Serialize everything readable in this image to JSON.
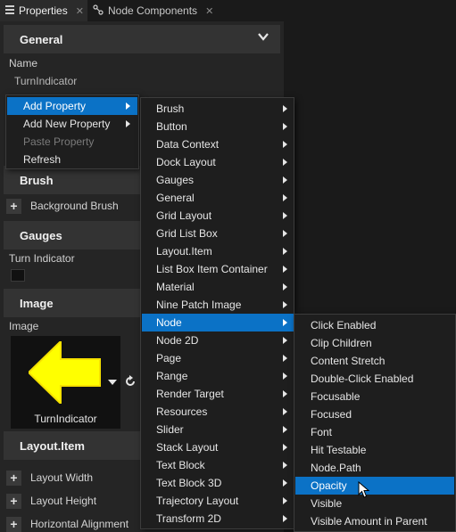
{
  "tabs": [
    {
      "label": "Properties",
      "icon": "properties-icon"
    },
    {
      "label": "Node Components",
      "icon": "node-components-icon"
    }
  ],
  "properties": {
    "general_header": "General",
    "name_label": "Name",
    "name_value": "TurnIndicator",
    "brush_header": "Brush",
    "background_brush": "Background Brush",
    "gauges_header": "Gauges",
    "turn_indicator_label": "Turn Indicator",
    "image_header": "Image",
    "image_label": "Image",
    "image_thumb_caption": "TurnIndicator",
    "layout_header": "Layout.Item",
    "layout_width": "Layout Width",
    "layout_height": "Layout Height",
    "horizontal_alignment": "Horizontal Alignment"
  },
  "context_menu": {
    "items": [
      {
        "label": "Add Property",
        "submenu": true,
        "highlighted": true
      },
      {
        "label": "Add New Property",
        "submenu": true
      },
      {
        "label": "Paste Property",
        "disabled": true
      },
      {
        "label": "Refresh"
      }
    ]
  },
  "component_menu": {
    "items": [
      "Brush",
      "Button",
      "Data Context",
      "Dock Layout",
      "Gauges",
      "General",
      "Grid Layout",
      "Grid List Box",
      "Layout.Item",
      "List Box Item Container",
      "Material",
      "Nine Patch Image",
      "Node",
      "Node 2D",
      "Page",
      "Range",
      "Render Target",
      "Resources",
      "Slider",
      "Stack Layout",
      "Text Block",
      "Text Block 3D",
      "Trajectory Layout",
      "Transform 2D"
    ],
    "highlighted": "Node"
  },
  "node_menu": {
    "items": [
      "Click Enabled",
      "Clip Children",
      "Content Stretch",
      "Double-Click Enabled",
      "Focusable",
      "Focused",
      "Font",
      "Hit Testable",
      "Node.Path",
      "Opacity",
      "Visible",
      "Visible Amount in Parent"
    ],
    "highlighted": "Opacity"
  },
  "colors": {
    "highlight": "#0b72c6",
    "arrow_yellow": "#ffff00"
  }
}
